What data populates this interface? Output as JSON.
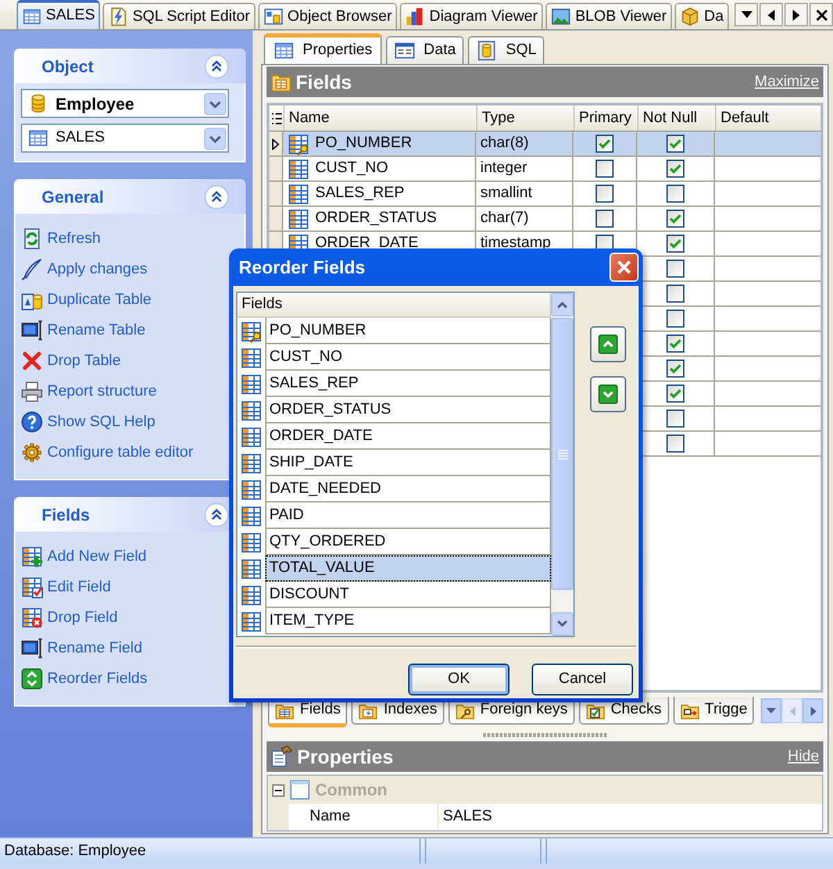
{
  "document_tabs": [
    {
      "label": "SALES",
      "selected": true
    },
    {
      "label": "SQL Script Editor",
      "selected": false
    },
    {
      "label": "Object Browser",
      "selected": false
    },
    {
      "label": "Diagram Viewer",
      "selected": false
    },
    {
      "label": "BLOB Viewer",
      "selected": false
    },
    {
      "label": "Da",
      "selected": false
    }
  ],
  "sidebar": {
    "panels": [
      {
        "title": "Object",
        "expanded": true,
        "combos": [
          {
            "kind": "database",
            "value": "Employee"
          },
          {
            "kind": "table",
            "value": "SALES"
          }
        ]
      },
      {
        "title": "General",
        "expanded": true,
        "items": [
          "Refresh",
          "Apply changes",
          "Duplicate Table",
          "Rename Table",
          "Drop Table",
          "Report structure",
          "Show SQL Help",
          "Configure table editor"
        ]
      },
      {
        "title": "Fields",
        "expanded": true,
        "items": [
          "Add New Field",
          "Edit Field",
          "Drop Field",
          "Rename Field",
          "Reorder Fields"
        ]
      }
    ]
  },
  "editor_tabs": [
    {
      "label": "Properties",
      "selected": true
    },
    {
      "label": "Data",
      "selected": false
    },
    {
      "label": "SQL",
      "selected": false
    }
  ],
  "fields_panel": {
    "title": "Fields",
    "action": "Maximize",
    "columns": [
      "Name",
      "Type",
      "Primary",
      "Not Null",
      "Default"
    ],
    "rows": [
      {
        "kind": "key",
        "name": "PO_NUMBER",
        "type": "char(8)",
        "primary": true,
        "not_null": true,
        "selected": true
      },
      {
        "kind": "field",
        "name": "CUST_NO",
        "type": "integer",
        "primary": false,
        "not_null": true,
        "selected": false
      },
      {
        "kind": "field",
        "name": "SALES_REP",
        "type": "smallint",
        "primary": false,
        "not_null": false,
        "selected": false
      },
      {
        "kind": "field",
        "name": "ORDER_STATUS",
        "type": "char(7)",
        "primary": false,
        "not_null": true,
        "selected": false
      },
      {
        "kind": "field",
        "name": "ORDER_DATE",
        "type": "timestamp",
        "primary": false,
        "not_null": true,
        "selected": false
      },
      {
        "not_null": false,
        "selected": false
      },
      {
        "not_null": false,
        "selected": false
      },
      {
        "not_null": false,
        "selected": false
      },
      {
        "not_null": true,
        "selected": false
      },
      {
        "not_null": true,
        "selected": false
      },
      {
        "not_null": true,
        "selected": false
      },
      {
        "not_null": false,
        "selected": false
      },
      {
        "not_null": false,
        "selected": false
      }
    ]
  },
  "bottom_tabs": [
    {
      "label": "Fields",
      "selected": true
    },
    {
      "label": "Indexes",
      "selected": false
    },
    {
      "label": "Foreign keys",
      "selected": false
    },
    {
      "label": "Checks",
      "selected": false
    },
    {
      "label": "Trigge",
      "selected": false
    }
  ],
  "properties_panel": {
    "title": "Properties",
    "action": "Hide",
    "groups": [
      {
        "label": "Common",
        "expanded": true,
        "rows": [
          {
            "name": "Name",
            "value": "SALES"
          }
        ]
      }
    ]
  },
  "status_bar": {
    "text": "Database: Employee"
  },
  "dialog": {
    "title": "Reorder Fields",
    "list_header": "Fields",
    "items": [
      {
        "kind": "key",
        "label": "PO_NUMBER",
        "selected": false
      },
      {
        "kind": "field",
        "label": "CUST_NO",
        "selected": false
      },
      {
        "kind": "field",
        "label": "SALES_REP",
        "selected": false
      },
      {
        "kind": "field",
        "label": "ORDER_STATUS",
        "selected": false
      },
      {
        "kind": "field",
        "label": "ORDER_DATE",
        "selected": false
      },
      {
        "kind": "field",
        "label": "SHIP_DATE",
        "selected": false
      },
      {
        "kind": "field",
        "label": "DATE_NEEDED",
        "selected": false
      },
      {
        "kind": "field",
        "label": "PAID",
        "selected": false
      },
      {
        "kind": "field",
        "label": "QTY_ORDERED",
        "selected": false
      },
      {
        "kind": "field",
        "label": "TOTAL_VALUE",
        "selected": true
      },
      {
        "kind": "field",
        "label": "DISCOUNT",
        "selected": false
      },
      {
        "kind": "field",
        "label": "ITEM_TYPE",
        "selected": false
      }
    ],
    "buttons": [
      {
        "label": "OK",
        "default": true
      },
      {
        "label": "Cancel",
        "default": false
      }
    ]
  }
}
